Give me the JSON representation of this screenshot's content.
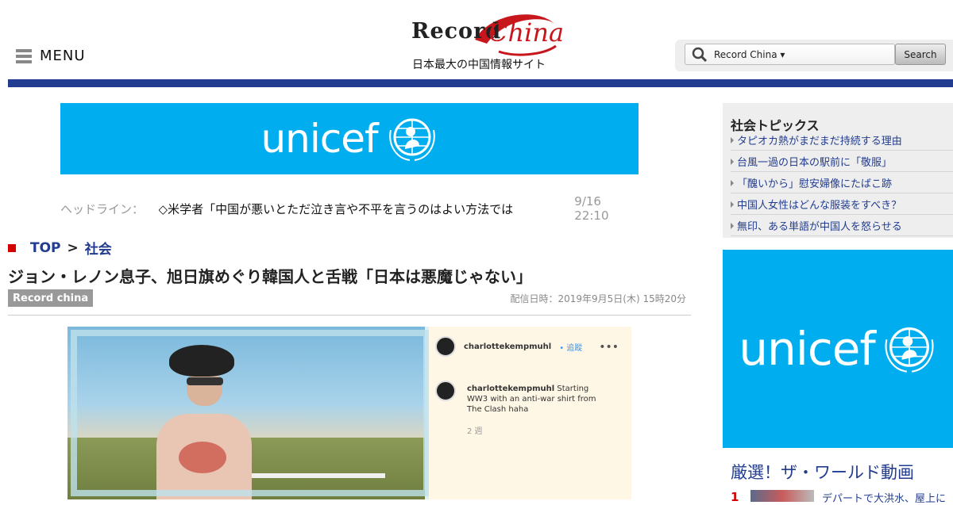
{
  "header": {
    "menu_label": "MENU",
    "logo_part1": "Record",
    "logo_part2": "China",
    "tagline": "日本最大の中国情報サイト",
    "search_scope": "Record China ▾",
    "search_button": "Search"
  },
  "banner": {
    "brand": "unicef"
  },
  "headline": {
    "label": "ヘッドライン：",
    "text": "◇米学者「中国が悪いとただ泣き言や不平を言うのはよい方法では",
    "time": "9/16 22:10"
  },
  "breadcrumb": {
    "top": "TOP",
    "separator": ">",
    "category": "社会"
  },
  "article": {
    "title": "ジョン・レノン息子、旭日旗めぐり韓国人と舌戦「日本は悪魔じゃない」",
    "source": "Record china",
    "date": "配信日時：2019年9月5日(木) 15時20分"
  },
  "photo": {
    "username": "charlottekempmuhl",
    "follow": "• 追蹤",
    "comment_user": "charlottekempmuhl",
    "comment_text": "Starting WW3 with an anti-war shirt from The Clash haha",
    "comment_time": "2 週"
  },
  "sidebar": {
    "topics_title": "社会トピックス",
    "topics": [
      "タピオカ熱がまだまだ持続する理由",
      "台風一過の日本の駅前に「敬服」",
      "「醜いから」慰安婦像にたばこ跡",
      "中国人女性はどんな服装をすべき？",
      "無印、ある単語が中国人を怒らせる"
    ],
    "ad_brand": "unicef",
    "video_title": "厳選！ザ・ワールド動画",
    "video_rank": "1",
    "video_text": "デパートで大洪水、屋上に"
  },
  "colors": {
    "nav_blue": "#223d8f",
    "unicef_blue": "#00aeef",
    "accent_red": "#d40000"
  }
}
